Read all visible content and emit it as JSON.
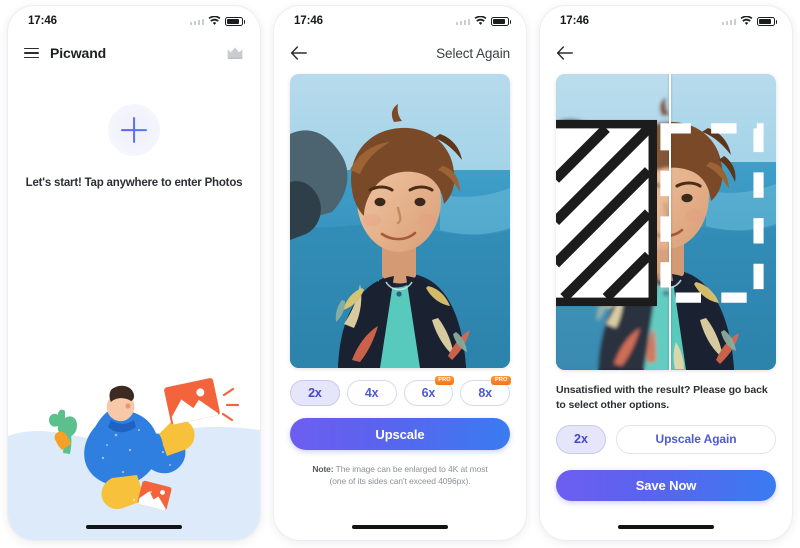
{
  "status_bar": {
    "time": "17:46",
    "signal_icon": "signal-dots-icon",
    "wifi_icon": "wifi-icon",
    "battery_icon": "battery-icon"
  },
  "colors": {
    "accent_purple": "#6d5ef0",
    "accent_blue": "#3a7bf0",
    "pill_selected_bg": "#e6e6fa",
    "pill_text": "#4d5bd0",
    "pro_badge": "#f97216"
  },
  "screen1": {
    "menu_icon": "hamburger-menu-icon",
    "title": "Picwand",
    "crown_icon": "crown-icon",
    "plus_icon": "plus-icon",
    "start_text": "Let's start! Tap anywhere to enter Photos",
    "illustration": "person-with-photos-illustration"
  },
  "screen2": {
    "back_icon": "back-arrow-icon",
    "nav_action": "Select Again",
    "photo_alt": "portrait-photo-beach",
    "scale_options": [
      {
        "label": "2x",
        "selected": true,
        "pro": false
      },
      {
        "label": "4x",
        "selected": false,
        "pro": false
      },
      {
        "label": "6x",
        "selected": false,
        "pro": true,
        "badge": "PRO"
      },
      {
        "label": "8x",
        "selected": false,
        "pro": true,
        "badge": "PRO"
      }
    ],
    "primary_button": "Upscale",
    "note_label": "Note:",
    "note_line1": " The image can be enlarged to 4K at most",
    "note_line2": "(one of its sides can't exceed 4096px)."
  },
  "screen3": {
    "back_icon": "back-arrow-icon",
    "photo_alt": "portrait-photo-before-after-compare",
    "compare_icon": "compare-slider-icon",
    "result_message": "Unsatisfied with the result? Please go back to select other options.",
    "scale_pill": "2x",
    "secondary_button": "Upscale Again",
    "primary_button": "Save Now"
  }
}
